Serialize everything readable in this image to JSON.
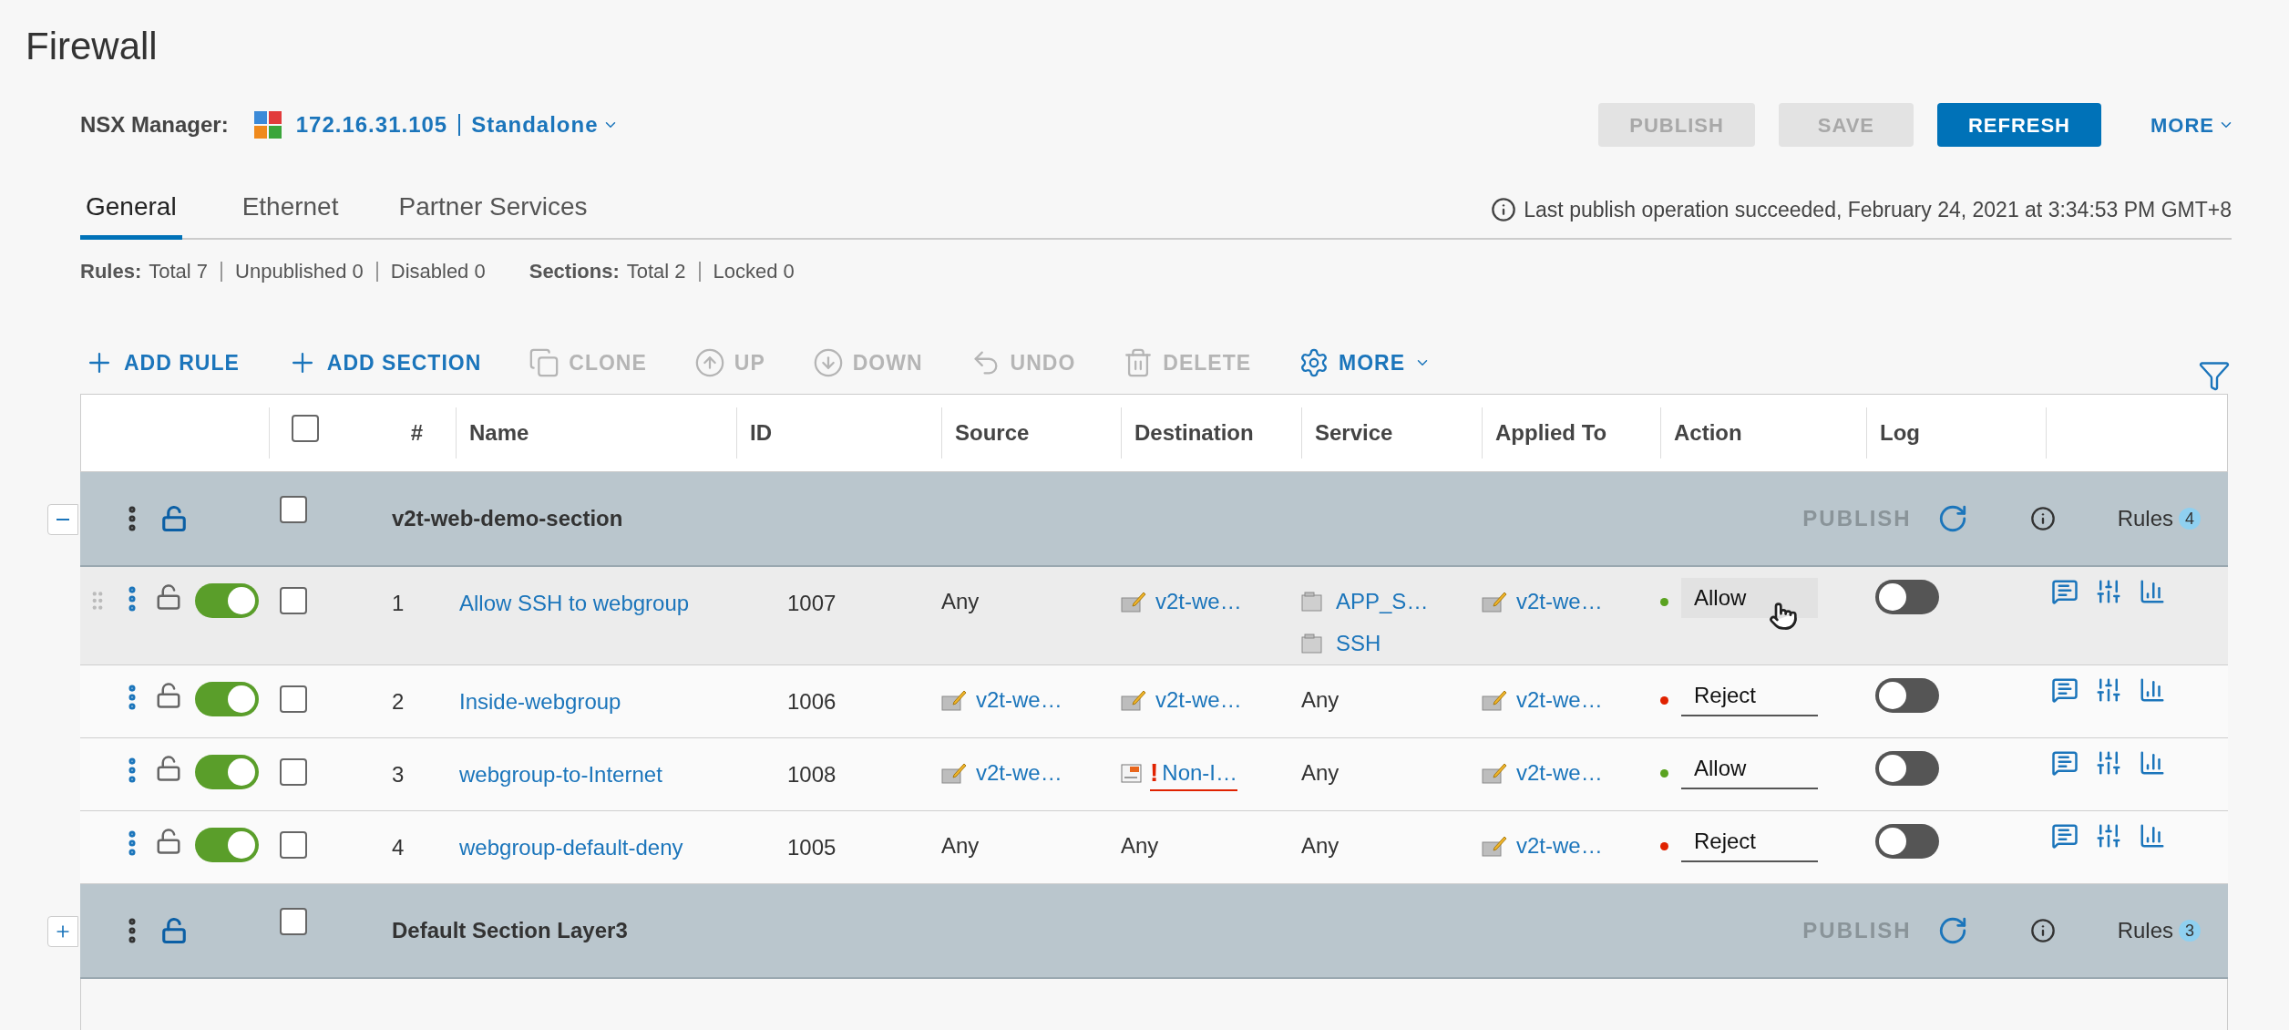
{
  "page": {
    "title": "Firewall"
  },
  "manager": {
    "label": "NSX Manager:",
    "address": "172.16.31.105",
    "mode": "Standalone"
  },
  "actions": [
    {
      "label": "PUBLISH",
      "kind": "primary",
      "disabled": true
    },
    {
      "label": "SAVE",
      "kind": "primary",
      "disabled": true
    },
    {
      "label": "REFRESH",
      "kind": "primary",
      "disabled": false
    },
    {
      "label": "MORE",
      "kind": "link",
      "disabled": false
    }
  ],
  "tabs": [
    {
      "label": "General",
      "selected": true
    },
    {
      "label": "Ethernet",
      "selected": false
    },
    {
      "label": "Partner Services",
      "selected": false
    }
  ],
  "status_message": "Last publish operation succeeded, February 24, 2021 at 3:34:53 PM GMT+8",
  "summary": [
    {
      "label": "Rules:",
      "items": [
        "Total 7",
        "Unpublished 0",
        "Disabled 0"
      ]
    },
    {
      "label": "Sections:",
      "items": [
        "Total 2",
        "Locked 0"
      ]
    }
  ],
  "toolbar": [
    {
      "label": "ADD RULE",
      "kind": "add",
      "disabled": false
    },
    {
      "label": "ADD SECTION",
      "kind": "section",
      "disabled": false
    },
    {
      "label": "CLONE",
      "kind": "clone",
      "disabled": true
    },
    {
      "label": "UP",
      "kind": "up",
      "disabled": true
    },
    {
      "label": "DOWN",
      "kind": "down",
      "disabled": true
    },
    {
      "label": "UNDO",
      "kind": "undo",
      "disabled": true
    },
    {
      "label": "DELETE",
      "kind": "delete",
      "disabled": true
    },
    {
      "label": "MORE",
      "kind": "settings",
      "disabled": false
    }
  ],
  "table": {
    "columns": [
      "#",
      "Name",
      "ID",
      "Source",
      "Destination",
      "Service",
      "Applied To",
      "Action",
      "Log"
    ],
    "header_checked": false,
    "sections": [
      {
        "name": "v2t-web-demo-section",
        "expanded": true,
        "checked": false,
        "locked": false,
        "publish": "PUBLISH",
        "rules_label": "Rules",
        "rules_count": "4",
        "rules": [
          {
            "number": "1",
            "name": "Allow SSH to webgroup",
            "id": "1007",
            "enabled": true,
            "locked": false,
            "checked": false,
            "hovered": true,
            "source": [
              {
                "kind": "any",
                "text": "Any"
              }
            ],
            "destination": [
              {
                "kind": "group",
                "text": "v2t-we…"
              }
            ],
            "service": [
              {
                "kind": "service",
                "text": "APP_S…"
              },
              {
                "kind": "service",
                "text": "SSH"
              }
            ],
            "applied_to": [
              {
                "kind": "group",
                "text": "v2t-we…"
              }
            ],
            "action": {
              "text": "Allow",
              "color": "#5aa220"
            },
            "log": false
          },
          {
            "number": "2",
            "name": "Inside-webgroup",
            "id": "1006",
            "enabled": true,
            "locked": false,
            "checked": false,
            "hovered": false,
            "source": [
              {
                "kind": "group",
                "text": "v2t-we…"
              }
            ],
            "destination": [
              {
                "kind": "group",
                "text": "v2t-we…"
              }
            ],
            "service": [
              {
                "kind": "any",
                "text": "Any"
              }
            ],
            "applied_to": [
              {
                "kind": "group",
                "text": "v2t-we…"
              }
            ],
            "action": {
              "text": "Reject",
              "color": "#e02200"
            },
            "log": false
          },
          {
            "number": "3",
            "name": "webgroup-to-Internet",
            "id": "1008",
            "enabled": true,
            "locked": false,
            "checked": false,
            "hovered": false,
            "source": [
              {
                "kind": "group",
                "text": "v2t-we…"
              }
            ],
            "destination": [
              {
                "kind": "invalid",
                "alert": "!",
                "text": "Non-I…"
              }
            ],
            "service": [
              {
                "kind": "any",
                "text": "Any"
              }
            ],
            "applied_to": [
              {
                "kind": "group",
                "text": "v2t-we…"
              }
            ],
            "action": {
              "text": "Allow",
              "color": "#5aa220"
            },
            "log": false
          },
          {
            "number": "4",
            "name": "webgroup-default-deny",
            "id": "1005",
            "enabled": true,
            "locked": false,
            "checked": false,
            "hovered": false,
            "source": [
              {
                "kind": "any",
                "text": "Any"
              }
            ],
            "destination": [
              {
                "kind": "any",
                "text": "Any"
              }
            ],
            "service": [
              {
                "kind": "any",
                "text": "Any"
              }
            ],
            "applied_to": [
              {
                "kind": "group",
                "text": "v2t-we…"
              }
            ],
            "action": {
              "text": "Reject",
              "color": "#e02200"
            },
            "log": false
          }
        ]
      },
      {
        "name": "Default Section Layer3",
        "expanded": false,
        "checked": false,
        "locked": false,
        "publish": "PUBLISH",
        "rules_label": "Rules",
        "rules_count": "3"
      }
    ]
  }
}
